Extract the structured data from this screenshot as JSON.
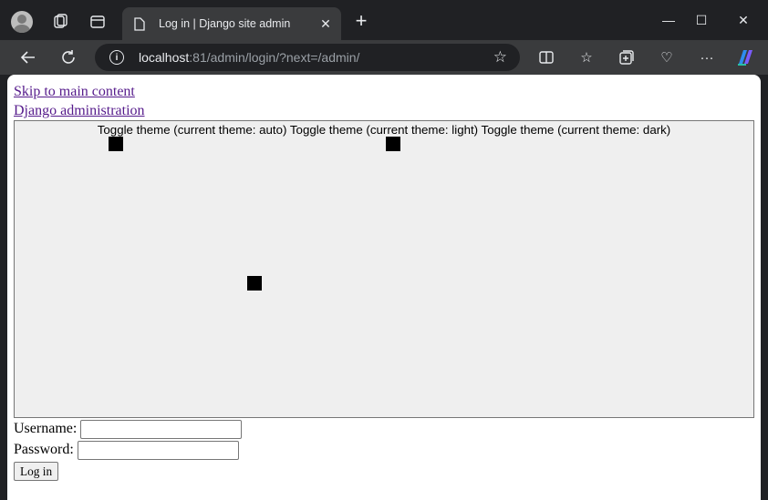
{
  "browser": {
    "tab_title": "Log in | Django site admin",
    "url_host": "localhost",
    "url_rest": ":81/admin/login/?next=/admin/"
  },
  "page": {
    "skip_link": "Skip to main content",
    "site_link": "Django administration",
    "theme_toggle_text": "Toggle theme (current theme: auto) Toggle theme (current theme: light) Toggle theme (current theme: dark)",
    "username_label": "Username:",
    "username_value": "",
    "password_label": "Password:",
    "password_value": "",
    "login_button": "Log in"
  },
  "icons": {
    "back": "back-arrow-icon",
    "reload": "reload-icon",
    "info": "site-info-icon",
    "favorite": "star-icon"
  }
}
